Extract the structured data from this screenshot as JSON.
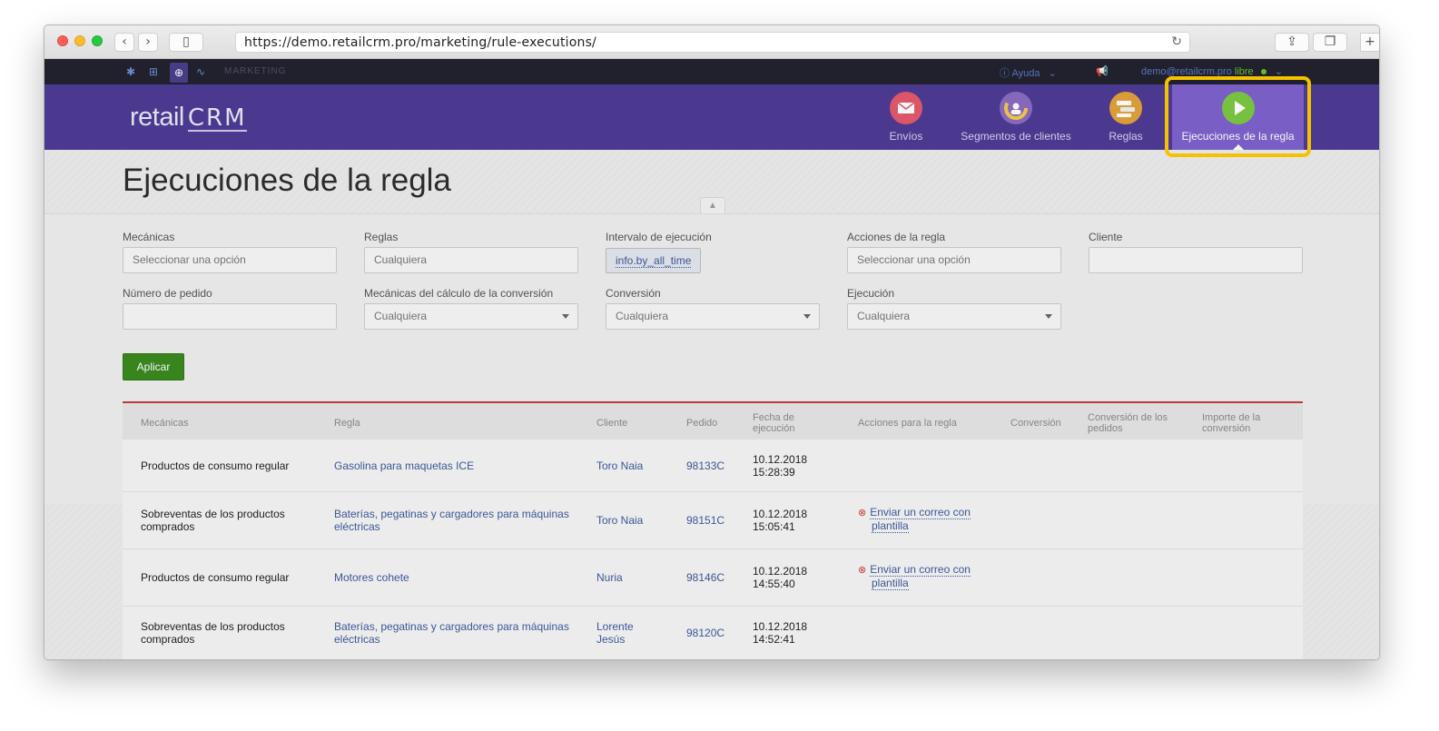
{
  "browser": {
    "url": "https://demo.retailcrm.pro/marketing/rule-executions/",
    "back_icon": "‹",
    "forward_icon": "›",
    "sidebar_icon": "▯",
    "reload_icon": "↻",
    "share_icon": "⇪",
    "tabs_icon": "❐",
    "newtab_icon": "+"
  },
  "topbar": {
    "section_label": "MARKETING",
    "help_label": "Ayuda",
    "user_email": "demo@retailcrm.pro",
    "plan_label": "libre"
  },
  "header": {
    "logo_text": "retail",
    "logo_crm": "CRM",
    "nav": [
      {
        "label": "Envíos",
        "icon": "mail-icon",
        "color": "#e05a6a"
      },
      {
        "label": "Segmentos de clientes",
        "icon": "segments-icon",
        "color": "#8a6cc0"
      },
      {
        "label": "Reglas",
        "icon": "rules-icon",
        "color": "#e0a23a"
      },
      {
        "label": "Ejecuciones de la regla",
        "icon": "play-icon",
        "color": "#7ac943"
      }
    ],
    "highlight_color": "#f5c200"
  },
  "page": {
    "title": "Ejecuciones de la regla"
  },
  "filters": {
    "mecanicas": {
      "label": "Mecánicas",
      "placeholder": "Seleccionar una opción"
    },
    "reglas": {
      "label": "Reglas",
      "placeholder": "Cualquiera"
    },
    "intervalo": {
      "label": "Intervalo de ejecución",
      "value": "info.by_all_time"
    },
    "acciones": {
      "label": "Acciones de la regla",
      "placeholder": "Seleccionar una opción"
    },
    "cliente": {
      "label": "Cliente",
      "value": ""
    },
    "numero_pedido": {
      "label": "Número de pedido",
      "value": ""
    },
    "mecanicas_calculo": {
      "label": "Mecánicas del cálculo de la conversión",
      "value": "Cualquiera"
    },
    "conversion": {
      "label": "Conversión",
      "value": "Cualquiera"
    },
    "ejecucion": {
      "label": "Ejecución",
      "value": "Cualquiera"
    },
    "apply_label": "Aplicar"
  },
  "table": {
    "headers": {
      "mecanicas": "Mecánicas",
      "regla": "Regla",
      "cliente": "Cliente",
      "pedido": "Pedido",
      "fecha_1": "Fecha de",
      "fecha_2": "ejecución",
      "acciones": "Acciones para la regla",
      "conversion": "Conversión",
      "conv_pedidos_1": "Conversión de los",
      "conv_pedidos_2": "pedidos",
      "importe_1": "Importe de la",
      "importe_2": "conversión"
    },
    "rows": [
      {
        "mecanica_1": "Productos de consumo regular",
        "mecanica_2": "",
        "regla_1": "Gasolina para maquetas ICE",
        "regla_2": "",
        "cliente_1": "Toro Naia",
        "cliente_2": "",
        "pedido": "98133C",
        "fecha": "10.12.2018",
        "hora": "15:28:39",
        "accion_1": "",
        "accion_2": ""
      },
      {
        "mecanica_1": "Sobreventas de los productos",
        "mecanica_2": "comprados",
        "regla_1": "Baterías, pegatinas y cargadores para máquinas",
        "regla_2": "eléctricas",
        "cliente_1": "Toro Naia",
        "cliente_2": "",
        "pedido": "98151C",
        "fecha": "10.12.2018",
        "hora": "15:05:41",
        "accion_1": "Enviar un correo con",
        "accion_2": "plantilla"
      },
      {
        "mecanica_1": "Productos de consumo regular",
        "mecanica_2": "",
        "regla_1": "Motores cohete",
        "regla_2": "",
        "cliente_1": "Nuria",
        "cliente_2": "",
        "pedido": "98146C",
        "fecha": "10.12.2018",
        "hora": "14:55:40",
        "accion_1": "Enviar un correo con",
        "accion_2": "plantilla"
      },
      {
        "mecanica_1": "Sobreventas de los productos",
        "mecanica_2": "comprados",
        "regla_1": "Baterías, pegatinas y cargadores para máquinas",
        "regla_2": "eléctricas",
        "cliente_1": "Lorente",
        "cliente_2": "Jesús",
        "pedido": "98120C",
        "fecha": "10.12.2018",
        "hora": "14:52:41",
        "accion_1": "",
        "accion_2": ""
      }
    ]
  }
}
